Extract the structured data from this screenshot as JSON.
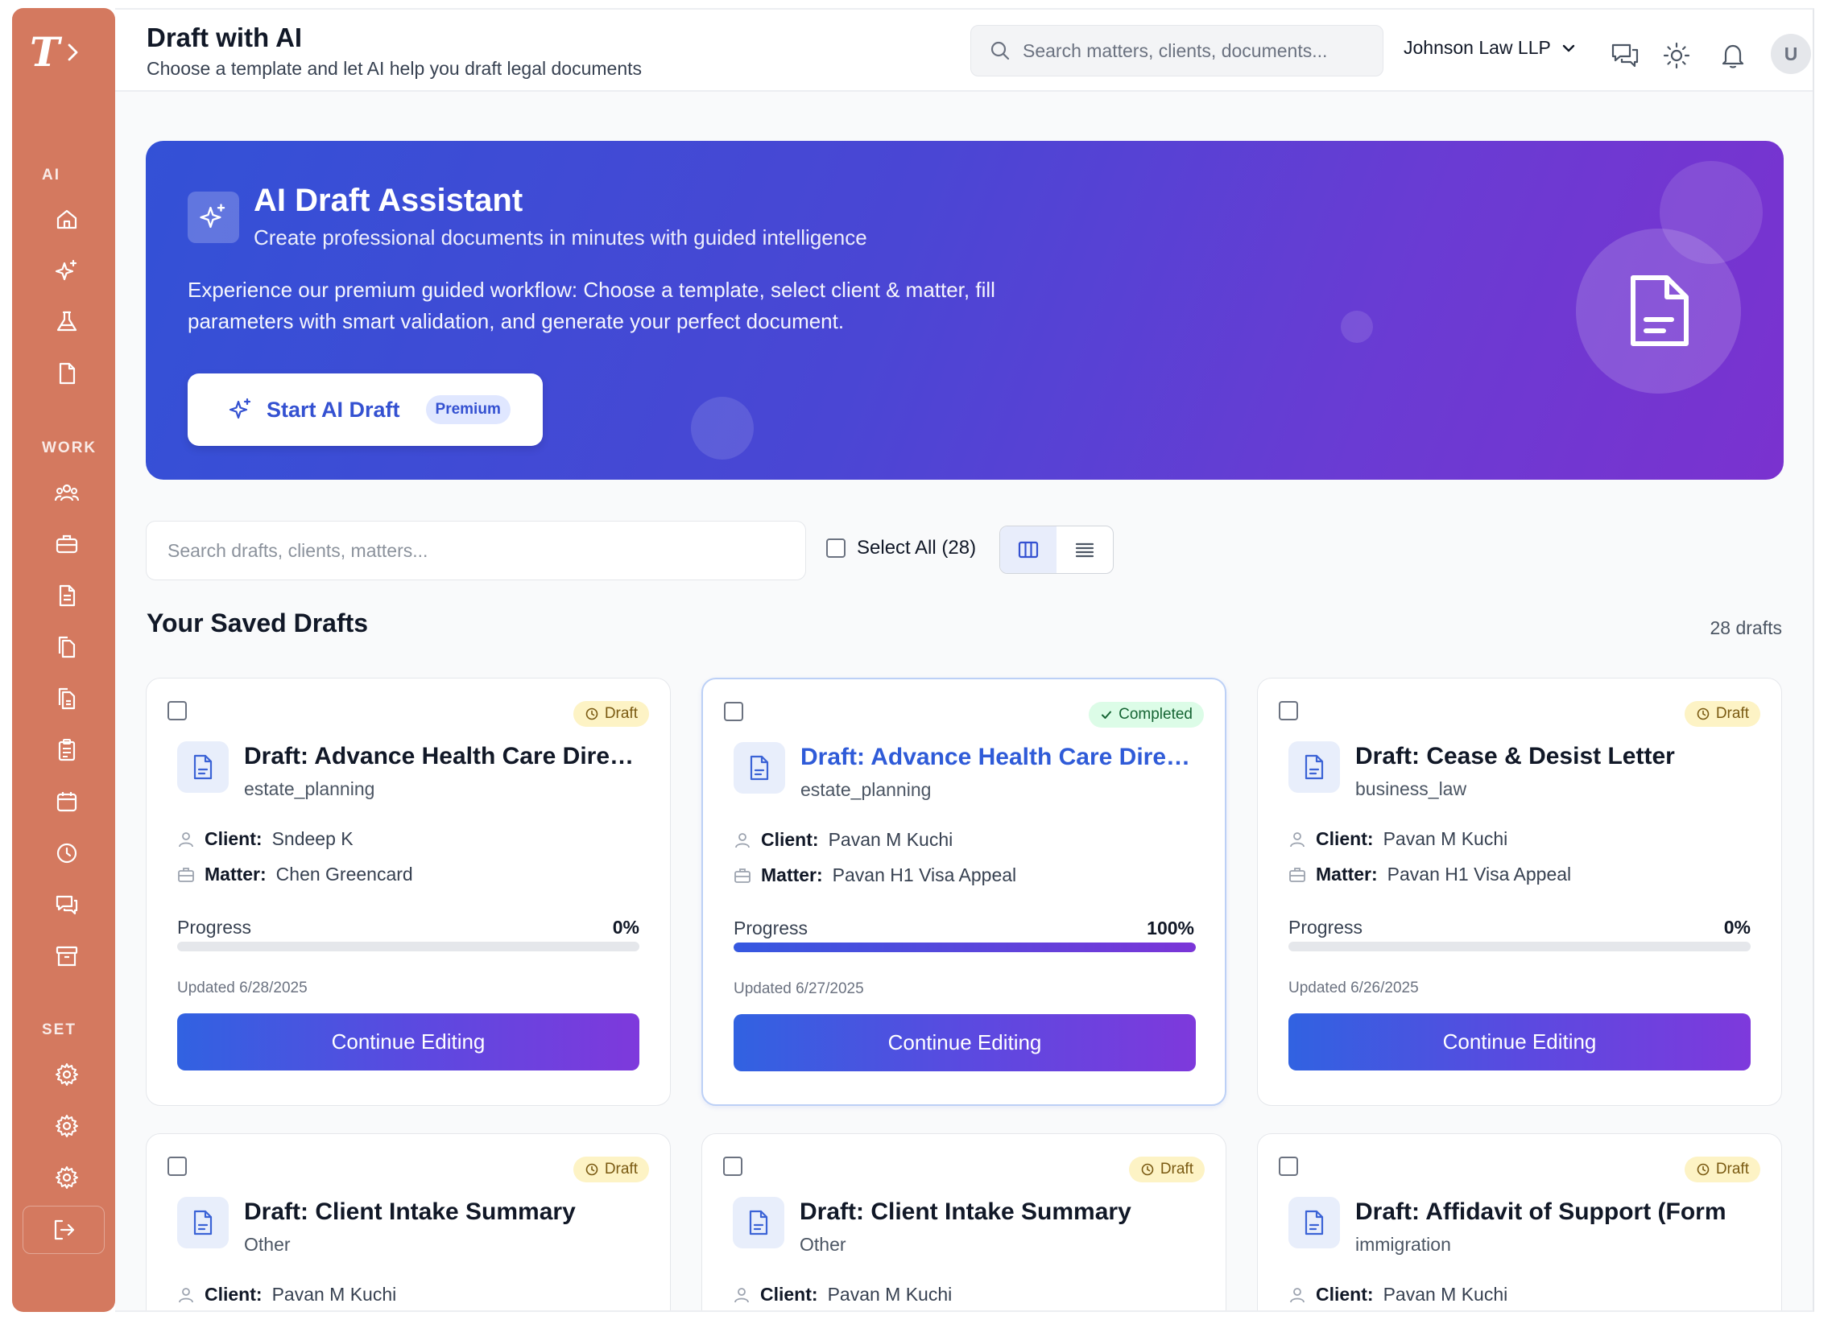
{
  "sidebar": {
    "logo_letter": "T",
    "sections": [
      {
        "label": "AI",
        "icons": [
          "home-icon",
          "sparkles-icon",
          "flask-icon",
          "document-icon"
        ]
      },
      {
        "label": "WORK",
        "icons": [
          "users-icon",
          "briefcase-icon",
          "file-text-icon",
          "files-icon",
          "documents-icon",
          "clipboard-icon",
          "calendar-icon",
          "clock-icon",
          "messages-icon",
          "archive-icon"
        ]
      },
      {
        "label": "SET",
        "icons": [
          "gear-icon",
          "gear-icon",
          "gear-icon"
        ]
      }
    ],
    "logout_icon": "logout-icon"
  },
  "header": {
    "title": "Draft with AI",
    "subtitle": "Choose a template and let AI help you draft legal documents",
    "search_placeholder": "Search matters, clients, documents...",
    "firm": "Johnson Law LLP",
    "avatar": "U"
  },
  "hero": {
    "title": "AI Draft Assistant",
    "subtitle": "Create professional documents in minutes with guided intelligence",
    "description": "Experience our premium guided workflow: Choose a template, select client & matter, fill parameters with smart validation, and generate your perfect document.",
    "cta_label": "Start AI Draft",
    "cta_badge": "Premium"
  },
  "toolbar": {
    "search_placeholder": "Search drafts, clients, matters...",
    "select_all_label": "Select All (28)"
  },
  "drafts": {
    "heading": "Your Saved Drafts",
    "count_label": "28 drafts",
    "client_label": "Client:",
    "matter_label": "Matter:",
    "progress_label": "Progress",
    "continue_label": "Continue Editing",
    "cards": [
      {
        "status": "Draft",
        "title": "Draft: Advance Health Care Directive",
        "category": "estate_planning",
        "client": "Sndeep K",
        "matter": "Chen Greencard",
        "progress": 0,
        "progress_text": "0%",
        "updated": "Updated 6/28/2025"
      },
      {
        "status": "Completed",
        "title": "Draft: Advance Health Care Directive",
        "category": "estate_planning",
        "client": "Pavan M Kuchi",
        "matter": "Pavan H1 Visa Appeal",
        "progress": 100,
        "progress_text": "100%",
        "updated": "Updated 6/27/2025"
      },
      {
        "status": "Draft",
        "title": "Draft: Cease & Desist Letter",
        "category": "business_law",
        "client": "Pavan M Kuchi",
        "matter": "Pavan H1 Visa Appeal",
        "progress": 0,
        "progress_text": "0%",
        "updated": "Updated 6/26/2025"
      },
      {
        "status": "Draft",
        "title": "Draft: Client Intake Summary",
        "category": "Other",
        "client": "Pavan M Kuchi"
      },
      {
        "status": "Draft",
        "title": "Draft: Client Intake Summary",
        "category": "Other",
        "client": "Pavan M Kuchi"
      },
      {
        "status": "Draft",
        "title": "Draft: Affidavit of Support (Form",
        "category": "immigration",
        "client": "Pavan M Kuchi"
      }
    ]
  },
  "colors": {
    "sidebar": "#d4795f",
    "accent": "#3451d1",
    "hero_start": "#3351d6",
    "hero_end": "#7a32cf",
    "draft_badge": "#fdf3c5",
    "completed_badge": "#dcfce7"
  }
}
